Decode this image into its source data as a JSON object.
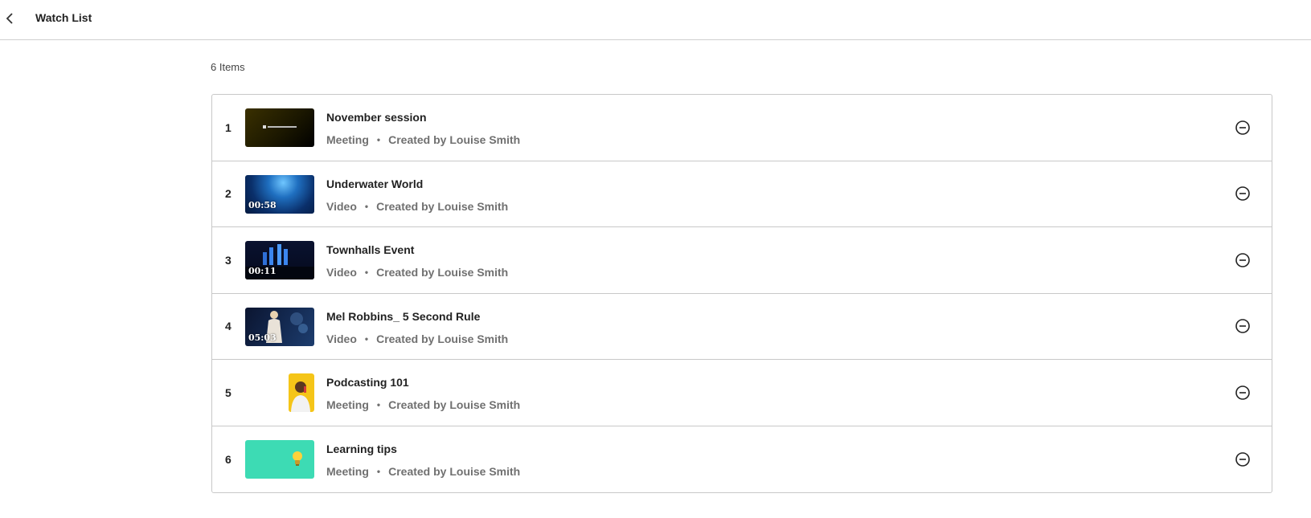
{
  "header": {
    "back_icon": "chevron-left-icon",
    "title": "Watch List"
  },
  "summary": {
    "count_text": "6 Items"
  },
  "items": [
    {
      "number": "1",
      "title": "November session",
      "type": "Meeting",
      "separator": "•",
      "creator": "Created by Louise Smith",
      "duration": "",
      "thumbnail": "kaltura-meetings-thumbnail",
      "remove_icon": "minus-circle-icon"
    },
    {
      "number": "2",
      "title": "Underwater World",
      "type": "Video",
      "separator": "•",
      "creator": "Created by Louise Smith",
      "duration": "00:58",
      "thumbnail": "underwater-thumbnail",
      "remove_icon": "minus-circle-icon"
    },
    {
      "number": "3",
      "title": "Townhalls Event",
      "type": "Video",
      "separator": "•",
      "creator": "Created by Louise Smith",
      "duration": "00:11",
      "thumbnail": "stage-thumbnail",
      "remove_icon": "minus-circle-icon"
    },
    {
      "number": "4",
      "title": "Mel Robbins_ 5 Second Rule",
      "type": "Video",
      "separator": "•",
      "creator": "Created by Louise Smith",
      "duration": "05:03",
      "thumbnail": "speaker-thumbnail",
      "remove_icon": "minus-circle-icon"
    },
    {
      "number": "5",
      "title": "Podcasting 101",
      "type": "Meeting",
      "separator": "•",
      "creator": "Created by Louise Smith",
      "duration": "",
      "thumbnail": "podcaster-thumbnail",
      "remove_icon": "minus-circle-icon"
    },
    {
      "number": "6",
      "title": "Learning tips",
      "type": "Meeting",
      "separator": "•",
      "creator": "Created by Louise Smith",
      "duration": "",
      "thumbnail": "lightbulb-thumbnail",
      "remove_icon": "minus-circle-icon"
    }
  ],
  "colors": {
    "divider": "#c8c8c8",
    "meta_text": "#707070",
    "thumb_teal": "#3ddbb4",
    "thumb_yellow": "#f5c518"
  }
}
